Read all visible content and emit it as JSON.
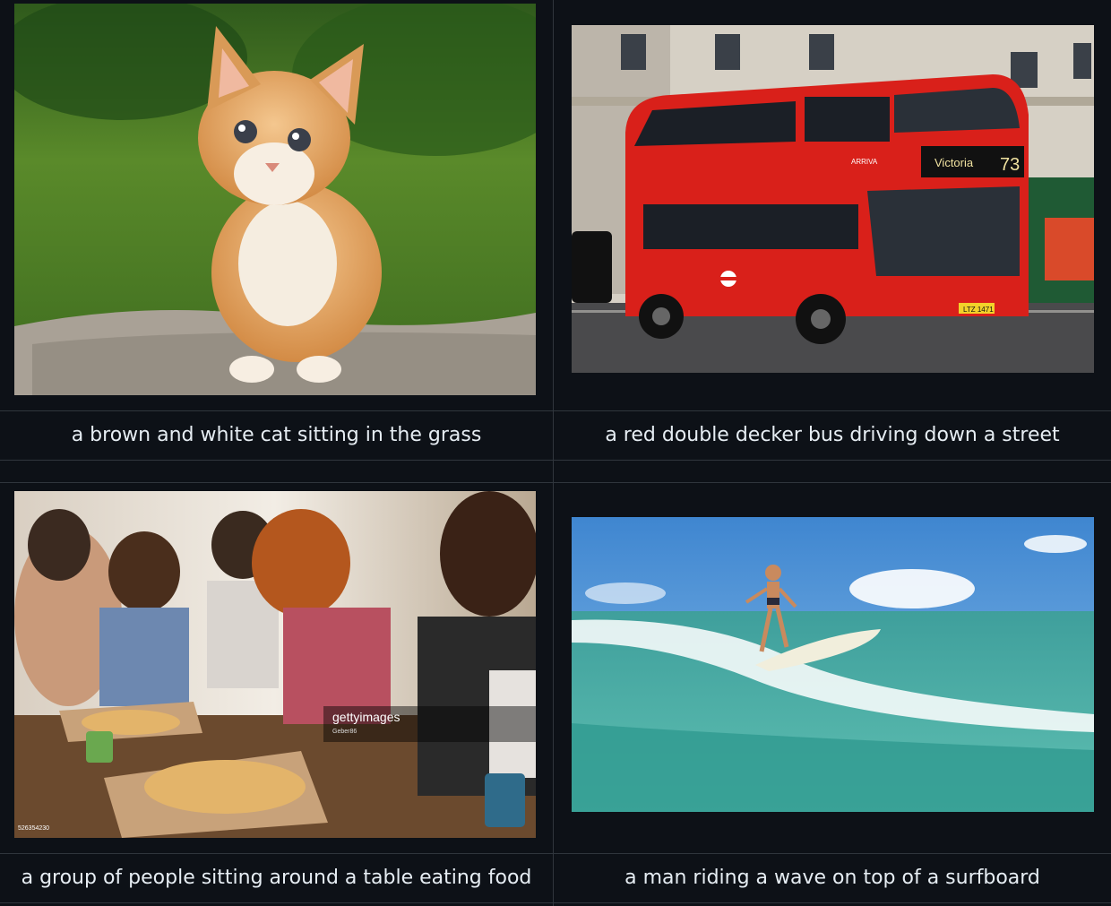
{
  "cells": [
    {
      "caption": "a brown and white cat sitting in the grass",
      "image_alt": "kitten-photo"
    },
    {
      "caption": "a red double decker bus driving down a street",
      "image_alt": "bus-photo",
      "bus_destination": "Victoria",
      "bus_route": "73",
      "bus_operator": "ARRIVA",
      "bus_plate": "LTZ 1471"
    },
    {
      "caption": "a group of people sitting around a table eating food",
      "image_alt": "pizza-party-photo",
      "watermark_brand": "gettyimages",
      "watermark_credit": "Geber86",
      "watermark_id": "526354230"
    },
    {
      "caption": "a man riding a wave on top of a surfboard",
      "image_alt": "surfer-photo"
    }
  ],
  "colors": {
    "background": "#0d1117",
    "border": "#30363d",
    "text": "#e6edf3"
  }
}
